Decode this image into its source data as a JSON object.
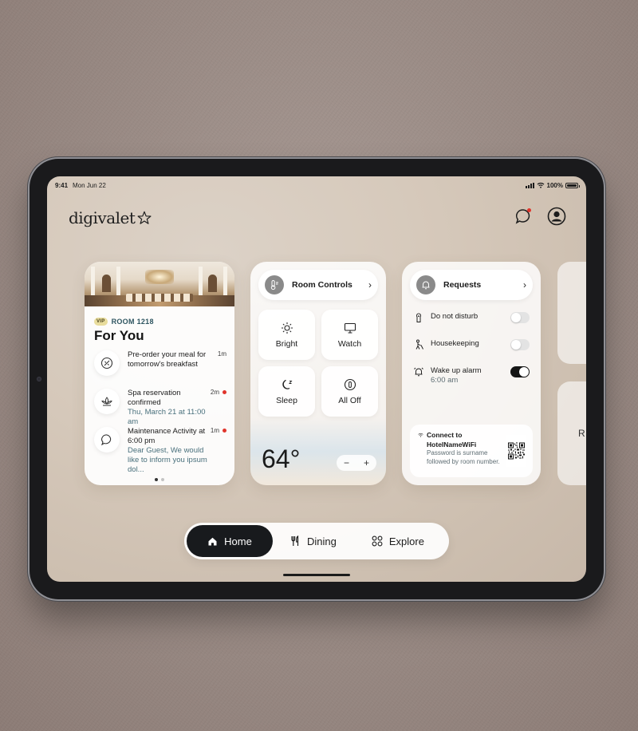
{
  "status_bar": {
    "time": "9:41",
    "date": "Mon Jun 22",
    "battery": "100%"
  },
  "brand": {
    "name": "digivalet",
    "icon": "star-icon"
  },
  "header": {
    "chat_icon": "chat-bubble-icon",
    "profile_icon": "profile-icon"
  },
  "for_you": {
    "badge": "VIP",
    "room": "ROOM 1218",
    "title": "For You",
    "items": [
      {
        "icon": "food-icon",
        "title": "Pre-order your meal for tomorrow's breakfast",
        "time": "1m",
        "unread": false
      },
      {
        "icon": "spa-lotus-icon",
        "title": "Spa reservation confirmed",
        "subtitle": "Thu, March 21 at 11:00 am",
        "time": "2m",
        "unread": true
      },
      {
        "icon": "message-icon",
        "title": "Maintenance Activity at 6:00 pm",
        "subtitle": "Dear Guest, We would like to inform you ipsum dol...",
        "time": "1m",
        "unread": true
      }
    ],
    "page_dots": 2,
    "active_dot": 0
  },
  "room_controls": {
    "title": "Room Controls",
    "icon": "thermostat-icon",
    "tiles": [
      {
        "label": "Bright",
        "icon": "sun-icon"
      },
      {
        "label": "Watch",
        "icon": "tv-icon"
      },
      {
        "label": "Sleep",
        "icon": "moon-icon"
      },
      {
        "label": "All Off",
        "icon": "power-icon"
      }
    ],
    "temperature": "64°",
    "minus": "−",
    "plus": "+"
  },
  "requests": {
    "title": "Requests",
    "icon": "bell-icon",
    "items": [
      {
        "label": "Do not disturb",
        "icon": "do-not-disturb-icon",
        "on": false
      },
      {
        "label": "Housekeeping",
        "icon": "housekeeping-icon",
        "on": false
      },
      {
        "label": "Wake up alarm",
        "sublabel": "6:00 am",
        "icon": "alarm-icon",
        "on": true
      }
    ],
    "wifi": {
      "title": "Connect to HotelNameWiFi",
      "note": "Password is surname followed by room number."
    }
  },
  "peek_cards": {
    "second_label": "R"
  },
  "nav": {
    "tabs": [
      {
        "label": "Home",
        "icon": "home-icon",
        "active": true
      },
      {
        "label": "Dining",
        "icon": "fork-knife-icon",
        "active": false
      },
      {
        "label": "Explore",
        "icon": "grid-icon",
        "active": false
      }
    ]
  }
}
